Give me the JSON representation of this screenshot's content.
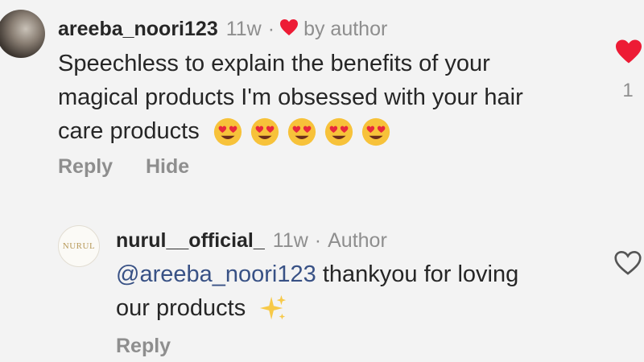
{
  "comment": {
    "username": "areeba_noori123",
    "time": "11w",
    "separator": "·",
    "liked_by": "by author",
    "text": "Speechless to explain the benefits of your magical products I'm obsessed with your hair care products",
    "emojis": [
      "smiling-face-with-heart-eyes",
      "smiling-face-with-heart-eyes",
      "smiling-face-with-heart-eyes",
      "smiling-face-with-heart-eyes",
      "smiling-face-with-heart-eyes"
    ],
    "reply_label": "Reply",
    "hide_label": "Hide",
    "like_count": "1",
    "like_state": "liked"
  },
  "reply": {
    "avatar_text": "NURUL",
    "username": "nurul__official_",
    "time": "11w",
    "separator": "·",
    "badge": "Author",
    "mention": "@areeba_noori123",
    "text": "thankyou for loving",
    "text_line2": "our products",
    "emoji": "sparkles",
    "reply_label": "Reply",
    "like_state": "not-liked"
  },
  "colors": {
    "background": "#f3f3f3",
    "heart_red": "#ed1b35",
    "mention_blue": "#385185",
    "secondary_text": "#8e8e8e"
  }
}
